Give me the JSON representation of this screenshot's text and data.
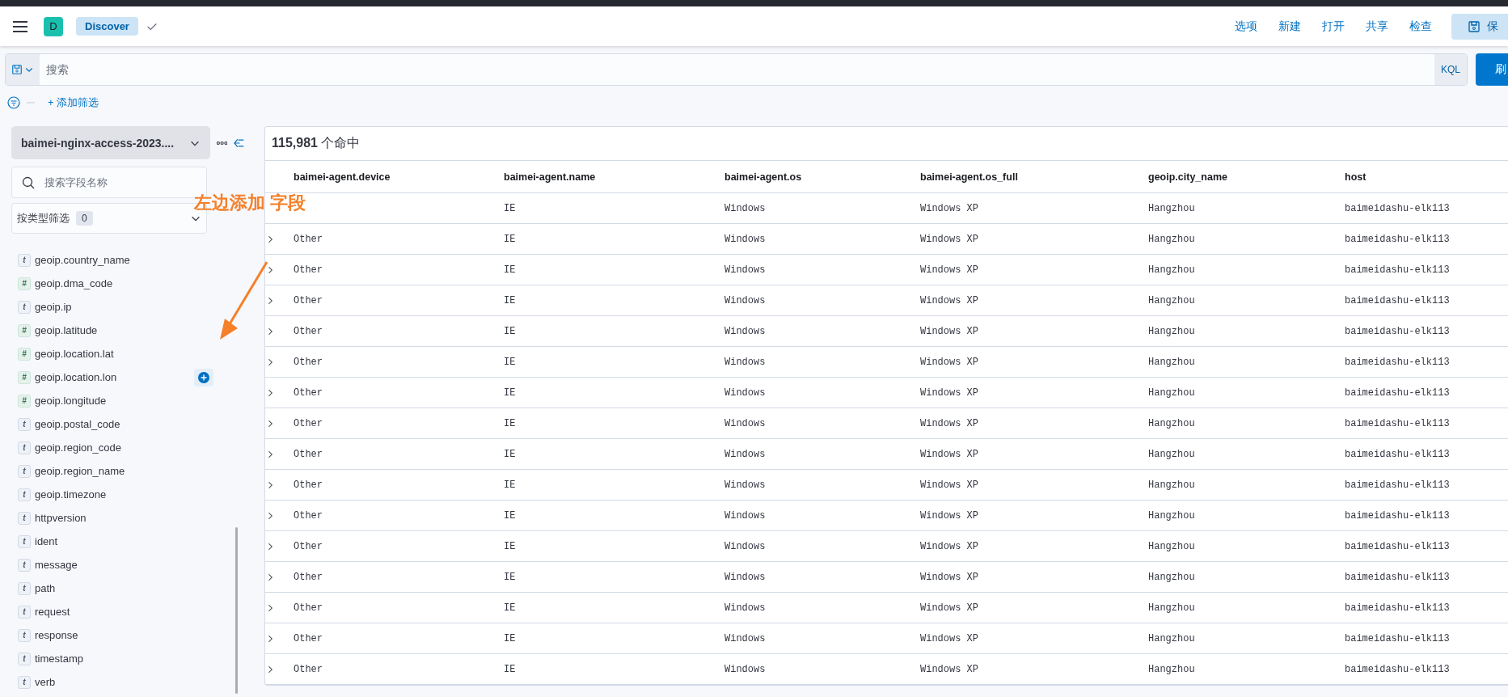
{
  "header": {
    "avatar": "D",
    "app": "Discover",
    "links": [
      "选项",
      "新建",
      "打开",
      "共享",
      "检查"
    ],
    "save_button": "保"
  },
  "query": {
    "placeholder": "搜索",
    "language": "KQL",
    "refresh_button": "刷"
  },
  "filter_bar": {
    "add_filter": "+ 添加筛选"
  },
  "sidebar": {
    "index_pattern": "baimei-nginx-access-2023....",
    "field_search": {
      "placeholder": "搜索字段名称"
    },
    "type_filter": {
      "label": "按类型筛选",
      "count": "0"
    },
    "fields": [
      {
        "name": "geoip.country_name",
        "kind": "text",
        "badge": "t",
        "hovered": false
      },
      {
        "name": "geoip.dma_code",
        "kind": "number",
        "badge": "#",
        "hovered": false
      },
      {
        "name": "geoip.ip",
        "kind": "text",
        "badge": "t",
        "hovered": false
      },
      {
        "name": "geoip.latitude",
        "kind": "number",
        "badge": "#",
        "hovered": false
      },
      {
        "name": "geoip.location.lat",
        "kind": "number",
        "badge": "#",
        "hovered": false
      },
      {
        "name": "geoip.location.lon",
        "kind": "number",
        "badge": "#",
        "hovered": true
      },
      {
        "name": "geoip.longitude",
        "kind": "number",
        "badge": "#",
        "hovered": false
      },
      {
        "name": "geoip.postal_code",
        "kind": "text",
        "badge": "t",
        "hovered": false
      },
      {
        "name": "geoip.region_code",
        "kind": "text",
        "badge": "t",
        "hovered": false
      },
      {
        "name": "geoip.region_name",
        "kind": "text",
        "badge": "t",
        "hovered": false
      },
      {
        "name": "geoip.timezone",
        "kind": "text",
        "badge": "t",
        "hovered": false
      },
      {
        "name": "httpversion",
        "kind": "text",
        "badge": "t",
        "hovered": false
      },
      {
        "name": "ident",
        "kind": "text",
        "badge": "t",
        "hovered": false
      },
      {
        "name": "message",
        "kind": "text",
        "badge": "t",
        "hovered": false
      },
      {
        "name": "path",
        "kind": "text",
        "badge": "t",
        "hovered": false
      },
      {
        "name": "request",
        "kind": "text",
        "badge": "t",
        "hovered": false
      },
      {
        "name": "response",
        "kind": "text",
        "badge": "t",
        "hovered": false
      },
      {
        "name": "timestamp",
        "kind": "text",
        "badge": "t",
        "hovered": false
      },
      {
        "name": "verb",
        "kind": "text",
        "badge": "t",
        "hovered": false
      }
    ]
  },
  "annotation": {
    "text": "左边添加 字段"
  },
  "results": {
    "hits": "115,981",
    "hits_label": "个命中",
    "columns": [
      "baimei-agent.device",
      "baimei-agent.name",
      "baimei-agent.os",
      "baimei-agent.os_full",
      "geoip.city_name",
      "host"
    ],
    "rows": [
      {
        "cells": [
          null,
          "IE",
          "Windows",
          "Windows XP",
          "Hangzhou",
          "baimeidashu-elk113"
        ]
      },
      {
        "cells": [
          "Other",
          "IE",
          "Windows",
          "Windows XP",
          "Hangzhou",
          "baimeidashu-elk113"
        ]
      },
      {
        "cells": [
          "Other",
          "IE",
          "Windows",
          "Windows XP",
          "Hangzhou",
          "baimeidashu-elk113"
        ]
      },
      {
        "cells": [
          "Other",
          "IE",
          "Windows",
          "Windows XP",
          "Hangzhou",
          "baimeidashu-elk113"
        ]
      },
      {
        "cells": [
          "Other",
          "IE",
          "Windows",
          "Windows XP",
          "Hangzhou",
          "baimeidashu-elk113"
        ]
      },
      {
        "cells": [
          "Other",
          "IE",
          "Windows",
          "Windows XP",
          "Hangzhou",
          "baimeidashu-elk113"
        ]
      },
      {
        "cells": [
          "Other",
          "IE",
          "Windows",
          "Windows XP",
          "Hangzhou",
          "baimeidashu-elk113"
        ]
      },
      {
        "cells": [
          "Other",
          "IE",
          "Windows",
          "Windows XP",
          "Hangzhou",
          "baimeidashu-elk113"
        ]
      },
      {
        "cells": [
          "Other",
          "IE",
          "Windows",
          "Windows XP",
          "Hangzhou",
          "baimeidashu-elk113"
        ]
      },
      {
        "cells": [
          "Other",
          "IE",
          "Windows",
          "Windows XP",
          "Hangzhou",
          "baimeidashu-elk113"
        ]
      },
      {
        "cells": [
          "Other",
          "IE",
          "Windows",
          "Windows XP",
          "Hangzhou",
          "baimeidashu-elk113"
        ]
      },
      {
        "cells": [
          "Other",
          "IE",
          "Windows",
          "Windows XP",
          "Hangzhou",
          "baimeidashu-elk113"
        ]
      },
      {
        "cells": [
          "Other",
          "IE",
          "Windows",
          "Windows XP",
          "Hangzhou",
          "baimeidashu-elk113"
        ]
      },
      {
        "cells": [
          "Other",
          "IE",
          "Windows",
          "Windows XP",
          "Hangzhou",
          "baimeidashu-elk113"
        ]
      },
      {
        "cells": [
          "Other",
          "IE",
          "Windows",
          "Windows XP",
          "Hangzhou",
          "baimeidashu-elk113"
        ]
      },
      {
        "cells": [
          "Other",
          "IE",
          "Windows",
          "Windows XP",
          "Hangzhou",
          "baimeidashu-elk113"
        ]
      }
    ]
  }
}
